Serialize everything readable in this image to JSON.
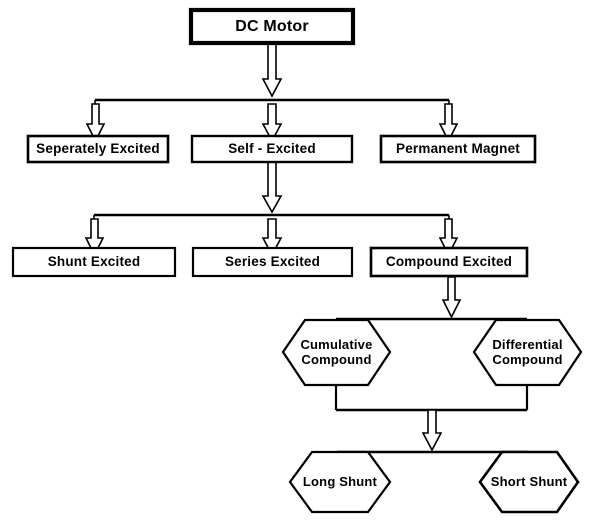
{
  "diagram": {
    "title": "DC Motor classification flowchart",
    "style": {
      "stroke_color": "#000000",
      "fill_color": "#ffffff",
      "background": "#ffffff"
    },
    "nodes": {
      "root": {
        "label": "DC Motor",
        "shape": "rectangle"
      },
      "separately_excited": {
        "label": "Seperately Excited",
        "shape": "rectangle"
      },
      "self_excited": {
        "label": "Self - Excited",
        "shape": "rectangle"
      },
      "permanent_magnet": {
        "label": "Permanent  Magnet",
        "shape": "rectangle"
      },
      "shunt_excited": {
        "label": "Shunt  Excited",
        "shape": "rectangle"
      },
      "series_excited": {
        "label": "Series  Excited",
        "shape": "rectangle"
      },
      "compound_excited": {
        "label": "Compound  Excited",
        "shape": "rectangle"
      },
      "cumulative_compound": {
        "label_line1": "Cumulative",
        "label_line2": "Compound",
        "shape": "hexagon"
      },
      "differential_compound": {
        "label_line1": "Differential",
        "label_line2": "Compound",
        "shape": "hexagon"
      },
      "long_shunt": {
        "label": "Long Shunt",
        "shape": "hexagon"
      },
      "short_shunt": {
        "label": "Short Shunt",
        "shape": "hexagon"
      }
    },
    "edges": [
      {
        "from": "root",
        "to": "separately_excited",
        "arrow": "hollow-down"
      },
      {
        "from": "root",
        "to": "self_excited",
        "arrow": "hollow-down"
      },
      {
        "from": "root",
        "to": "permanent_magnet",
        "arrow": "hollow-down"
      },
      {
        "from": "self_excited",
        "to": "shunt_excited",
        "arrow": "hollow-down"
      },
      {
        "from": "self_excited",
        "to": "series_excited",
        "arrow": "hollow-down"
      },
      {
        "from": "self_excited",
        "to": "compound_excited",
        "arrow": "hollow-down"
      },
      {
        "from": "compound_excited",
        "to": "cumulative_compound",
        "arrow": "hollow-down"
      },
      {
        "from": "compound_excited",
        "to": "differential_compound",
        "arrow": "hollow-down"
      },
      {
        "from": "cumulative_compound",
        "to": "long_shunt",
        "arrow": "hollow-down"
      },
      {
        "from": "cumulative_compound",
        "to": "short_shunt",
        "arrow": "hollow-down"
      },
      {
        "from": "differential_compound",
        "to": "long_shunt",
        "arrow": "hollow-down"
      },
      {
        "from": "differential_compound",
        "to": "short_shunt",
        "arrow": "hollow-down"
      }
    ]
  }
}
